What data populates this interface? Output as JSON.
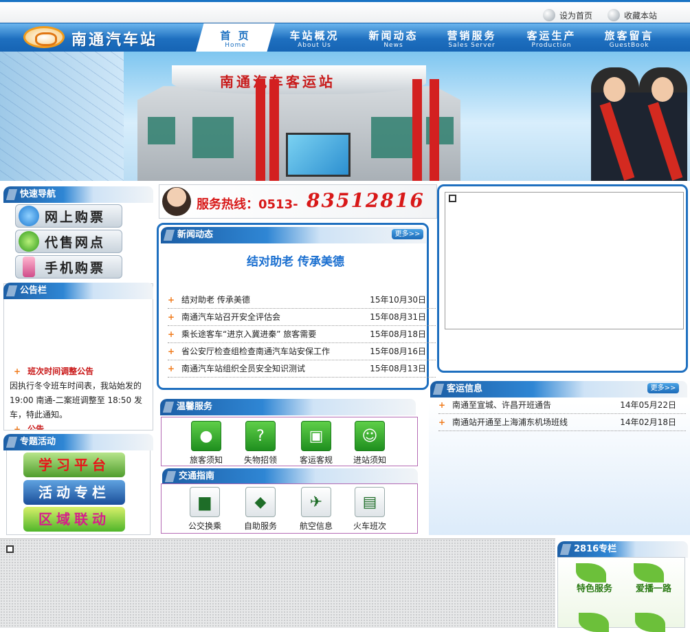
{
  "topbar": {
    "set_home": "设为首页",
    "bookmark": "收藏本站"
  },
  "header": {
    "site_name": "南通汽车站"
  },
  "nav": [
    {
      "cn": "首 页",
      "en": "Home"
    },
    {
      "cn": "车站概况",
      "en": "About Us"
    },
    {
      "cn": "新闻动态",
      "en": "News"
    },
    {
      "cn": "营销服务",
      "en": "Sales Server"
    },
    {
      "cn": "客运生产",
      "en": "Production"
    },
    {
      "cn": "旅客留言",
      "en": "GuestBook"
    }
  ],
  "banner": {
    "building_sign": "南通汽车客运站"
  },
  "quick_nav": {
    "title": "快速导航",
    "buttons": [
      "网上购票",
      "代售网点",
      "手机购票"
    ]
  },
  "notice": {
    "title": "公告栏",
    "heading": "班次时间调整公告",
    "body": "因执行冬令班车时间表，我站始发的19:00 南通-二案班调整至 18:50 发车，特此通知。",
    "next_heading": "公告"
  },
  "topics": {
    "title": "专题活动",
    "buttons": [
      "学习平台",
      "活动专栏",
      "区域联动"
    ]
  },
  "hotline": {
    "label": "服务热线：0513-",
    "number": "83512816"
  },
  "news": {
    "title": "新闻动态",
    "more": "更多>>",
    "featured": "结对助老 传承美德",
    "items": [
      {
        "title": "结对助老 传承美德",
        "date": "15年10月30日"
      },
      {
        "title": "南通汽车站召开安全评估会",
        "date": "15年08月31日"
      },
      {
        "title": "乘长途客车“进京入冀进秦” 旅客需要",
        "date": "15年08月18日"
      },
      {
        "title": "省公安厅检查组检查南通汽车站安保工作",
        "date": "15年08月16日"
      },
      {
        "title": "南通汽车站组织全员安全知识测试",
        "date": "15年08月13日"
      }
    ]
  },
  "services": {
    "title": "温馨服务",
    "items": [
      "旅客须知",
      "失物招领",
      "客运客规",
      "进站须知"
    ]
  },
  "traffic": {
    "title": "交通指南",
    "items": [
      "公交换乘",
      "自助服务",
      "航空信息",
      "火车班次"
    ]
  },
  "passenger": {
    "title": "客运信息",
    "more": "更多>>",
    "items": [
      {
        "title": "南通至宣城、许昌开班通告",
        "date": "14年05月22日"
      },
      {
        "title": "南通站开通至上海浦东机场班线",
        "date": "14年02月18日"
      }
    ]
  },
  "column2816": {
    "title": "2816专栏",
    "items": [
      "特色服务",
      "爱播一路"
    ]
  },
  "colors": {
    "nav_blue": "#1e6fbf",
    "accent_orange": "#f07a1a",
    "news_title_blue": "#1a6fd0",
    "hotline_red": "#d81818",
    "notice_red": "#c81414"
  }
}
